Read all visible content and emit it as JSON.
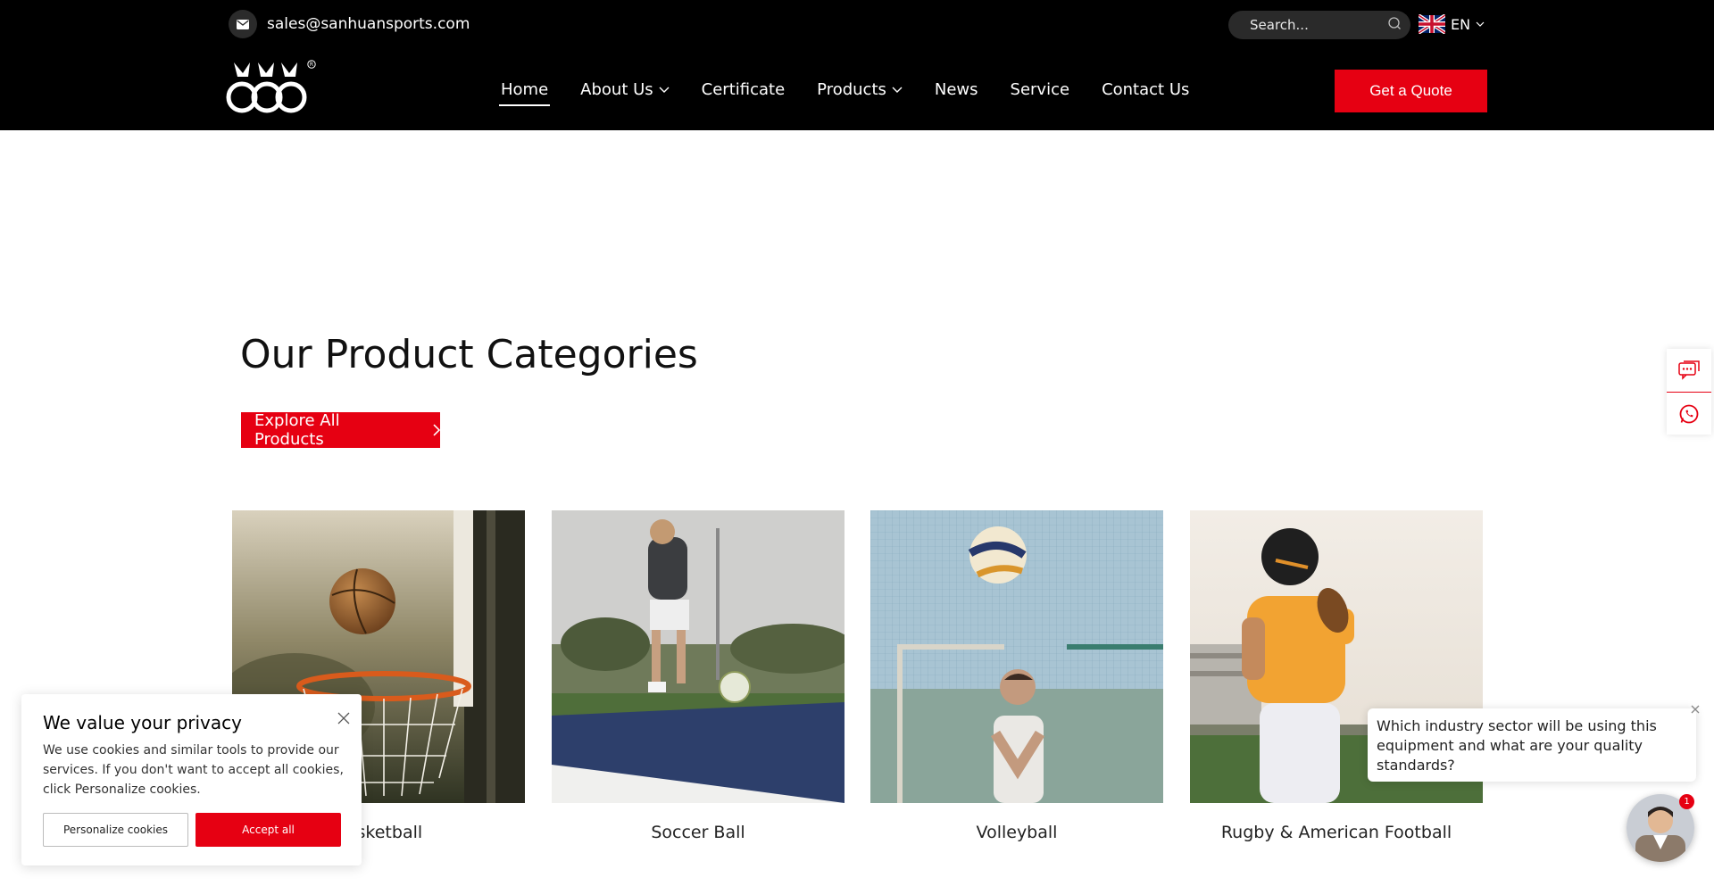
{
  "header": {
    "email": "sales@sanhuansports.com",
    "search_placeholder": "Search...",
    "language": "EN",
    "nav": [
      {
        "label": "Home"
      },
      {
        "label": "About Us"
      },
      {
        "label": "Certificate"
      },
      {
        "label": "Products"
      },
      {
        "label": "News"
      },
      {
        "label": "Service"
      },
      {
        "label": "Contact Us"
      }
    ],
    "quote_label": "Get a Quote"
  },
  "main": {
    "section_title": "Our Product Categories",
    "explore_label": "Explore All Products",
    "categories": [
      {
        "label": "Basketball"
      },
      {
        "label": "Soccer Ball"
      },
      {
        "label": "Volleyball"
      },
      {
        "label": "Rugby & American Football"
      }
    ]
  },
  "cookie": {
    "title": "We value your privacy",
    "text": "We use cookies and similar tools to provide our services. If you don't want to accept all cookies, click Personalize cookies.",
    "personalize_label": "Personalize cookies",
    "accept_label": "Accept all"
  },
  "chat": {
    "message": "Which industry sector will be using this equipment and what are your quality standards?",
    "badge_count": "1"
  },
  "colors": {
    "brand_red": "#e60012",
    "header_bg": "#000000"
  },
  "icons": [
    "mail-icon",
    "search-icon",
    "uk-flag-icon",
    "chevron-down-icon",
    "chevron-right-icon",
    "message-icon",
    "whatsapp-icon",
    "close-icon"
  ]
}
